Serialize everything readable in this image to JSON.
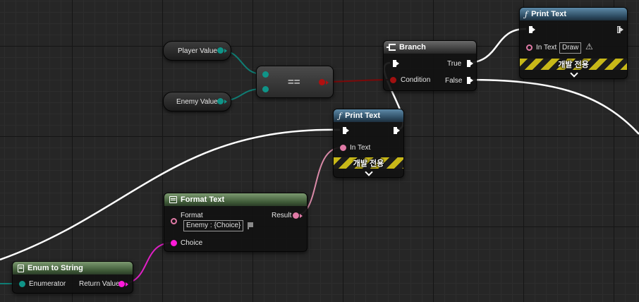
{
  "colors": {
    "exec_wire": "#ffffff",
    "enum_pin": "#0f9488",
    "bool_pin": "#8e0a0a",
    "text_pin": "#e07aa6",
    "string_pin": "#ff1ad9",
    "warning_stripe": "#c8b818"
  },
  "variables": {
    "player": {
      "label": "Player Value",
      "pin": "enum-pin"
    },
    "enemy": {
      "label": "Enemy Value",
      "pin": "enum-pin"
    }
  },
  "equal_node": {
    "symbol": "=="
  },
  "branch_node": {
    "title": "Branch",
    "icon": "branch-icon",
    "condition_label": "Condition",
    "true_label": "True",
    "false_label": "False"
  },
  "print_text_top": {
    "title": "Print Text",
    "icon": "function-icon",
    "in_text_label": "In Text",
    "in_text_value": "Draw",
    "warning_icon": "warning-icon",
    "dev_only_label": "개발 전용"
  },
  "print_text_mid": {
    "title": "Print Text",
    "icon": "function-icon",
    "in_text_label": "In Text",
    "dev_only_label": "개발 전용"
  },
  "format_text": {
    "title": "Format Text",
    "icon": "format-text-icon",
    "format_label": "Format",
    "format_value": "Enemy : {Choice}",
    "result_label": "Result",
    "choice_label": "Choice",
    "localize_icon": "flag-icon"
  },
  "enum_to_string": {
    "title": "Enum to String",
    "icon": "document-icon",
    "enumerator_label": "Enumerator",
    "return_label": "Return Value"
  }
}
